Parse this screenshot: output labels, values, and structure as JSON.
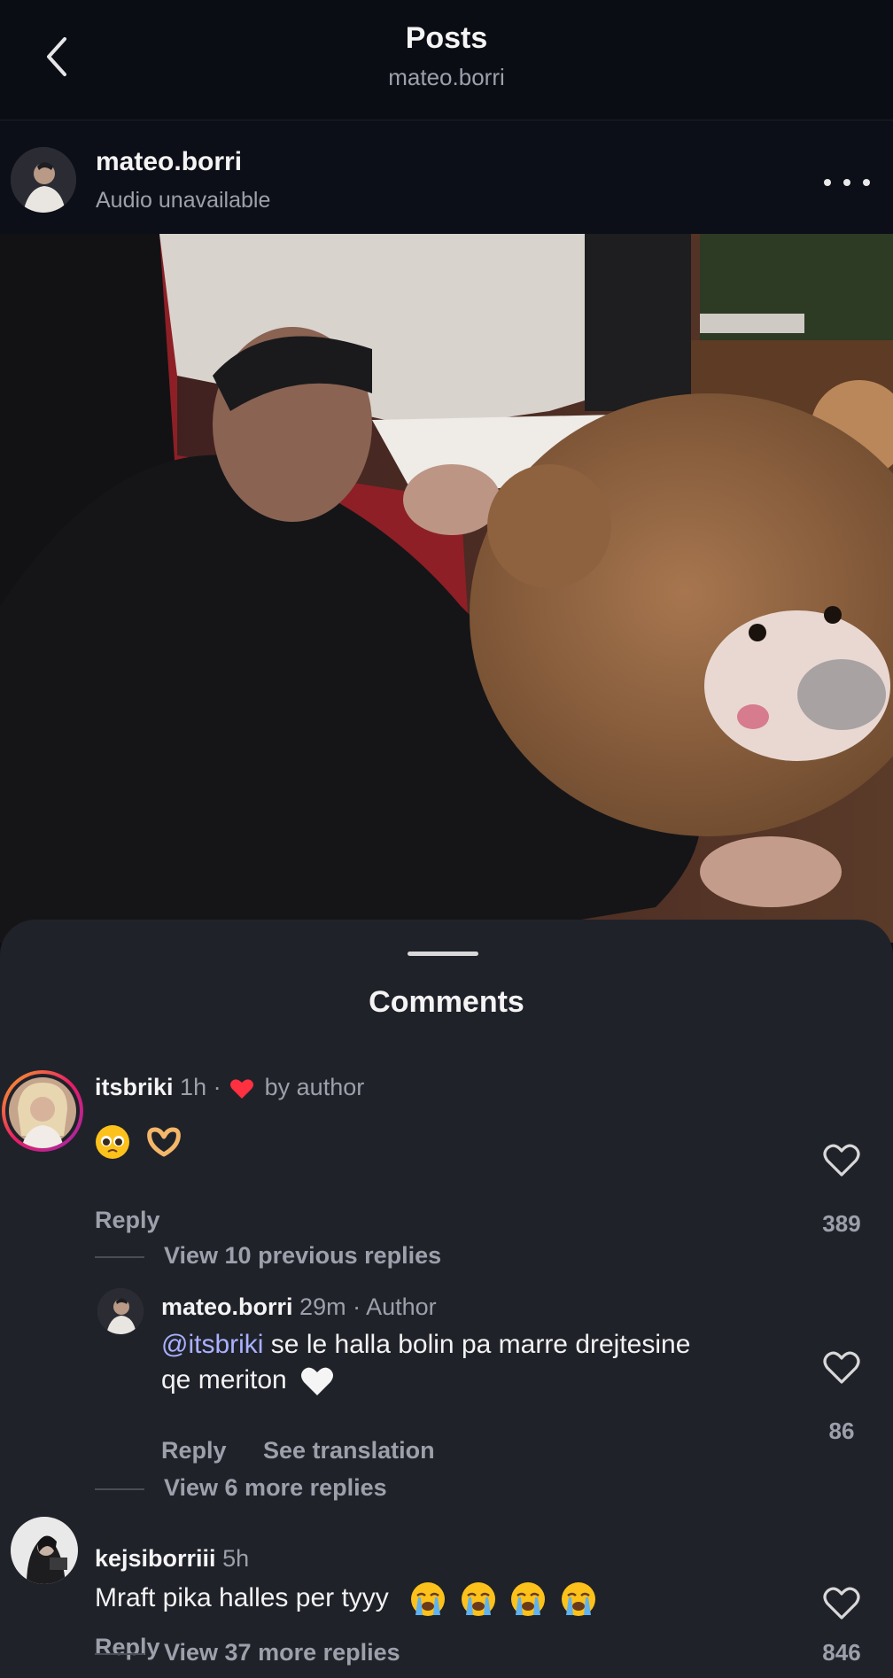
{
  "nav": {
    "title": "Posts",
    "subtitle": "mateo.borri"
  },
  "post": {
    "username": "mateo.borri",
    "audio_status": "Audio unavailable"
  },
  "comments_sheet": {
    "title": "Comments",
    "comments": [
      {
        "username": "itsbriki",
        "time": "1h",
        "separator": "·",
        "badge": "by author",
        "text_emojis": [
          "pleading-face",
          "heart-hands"
        ],
        "reply_label": "Reply",
        "likes": "389",
        "view_replies_label": "View 10 previous replies"
      },
      {
        "username": "mateo.borri",
        "time": "29m",
        "badge": "· Author",
        "mention": "@itsbriki",
        "text_line1": " se le halla bolin pa marre drejtesine",
        "text_line2": "qe meriton",
        "text_emoji": "white-heart",
        "reply_label": "Reply",
        "translate_label": "See translation",
        "likes": "86",
        "view_replies_label": "View 6 more replies"
      },
      {
        "username": "kejsiborriii",
        "time": "5h",
        "text": "Mraft pika halles per tyyy",
        "text_emojis": [
          "loudly-crying-face",
          "loudly-crying-face",
          "loudly-crying-face",
          "loudly-crying-face"
        ],
        "reply_label": "Reply",
        "likes": "846",
        "view_replies_label": "View 37 more replies"
      }
    ]
  },
  "colors": {
    "background": "#0d0f18",
    "sheet": "#20222a",
    "mention": "#a9b1ff",
    "heart_badge": "#ff3040",
    "muted_text": "#9da0aa"
  }
}
